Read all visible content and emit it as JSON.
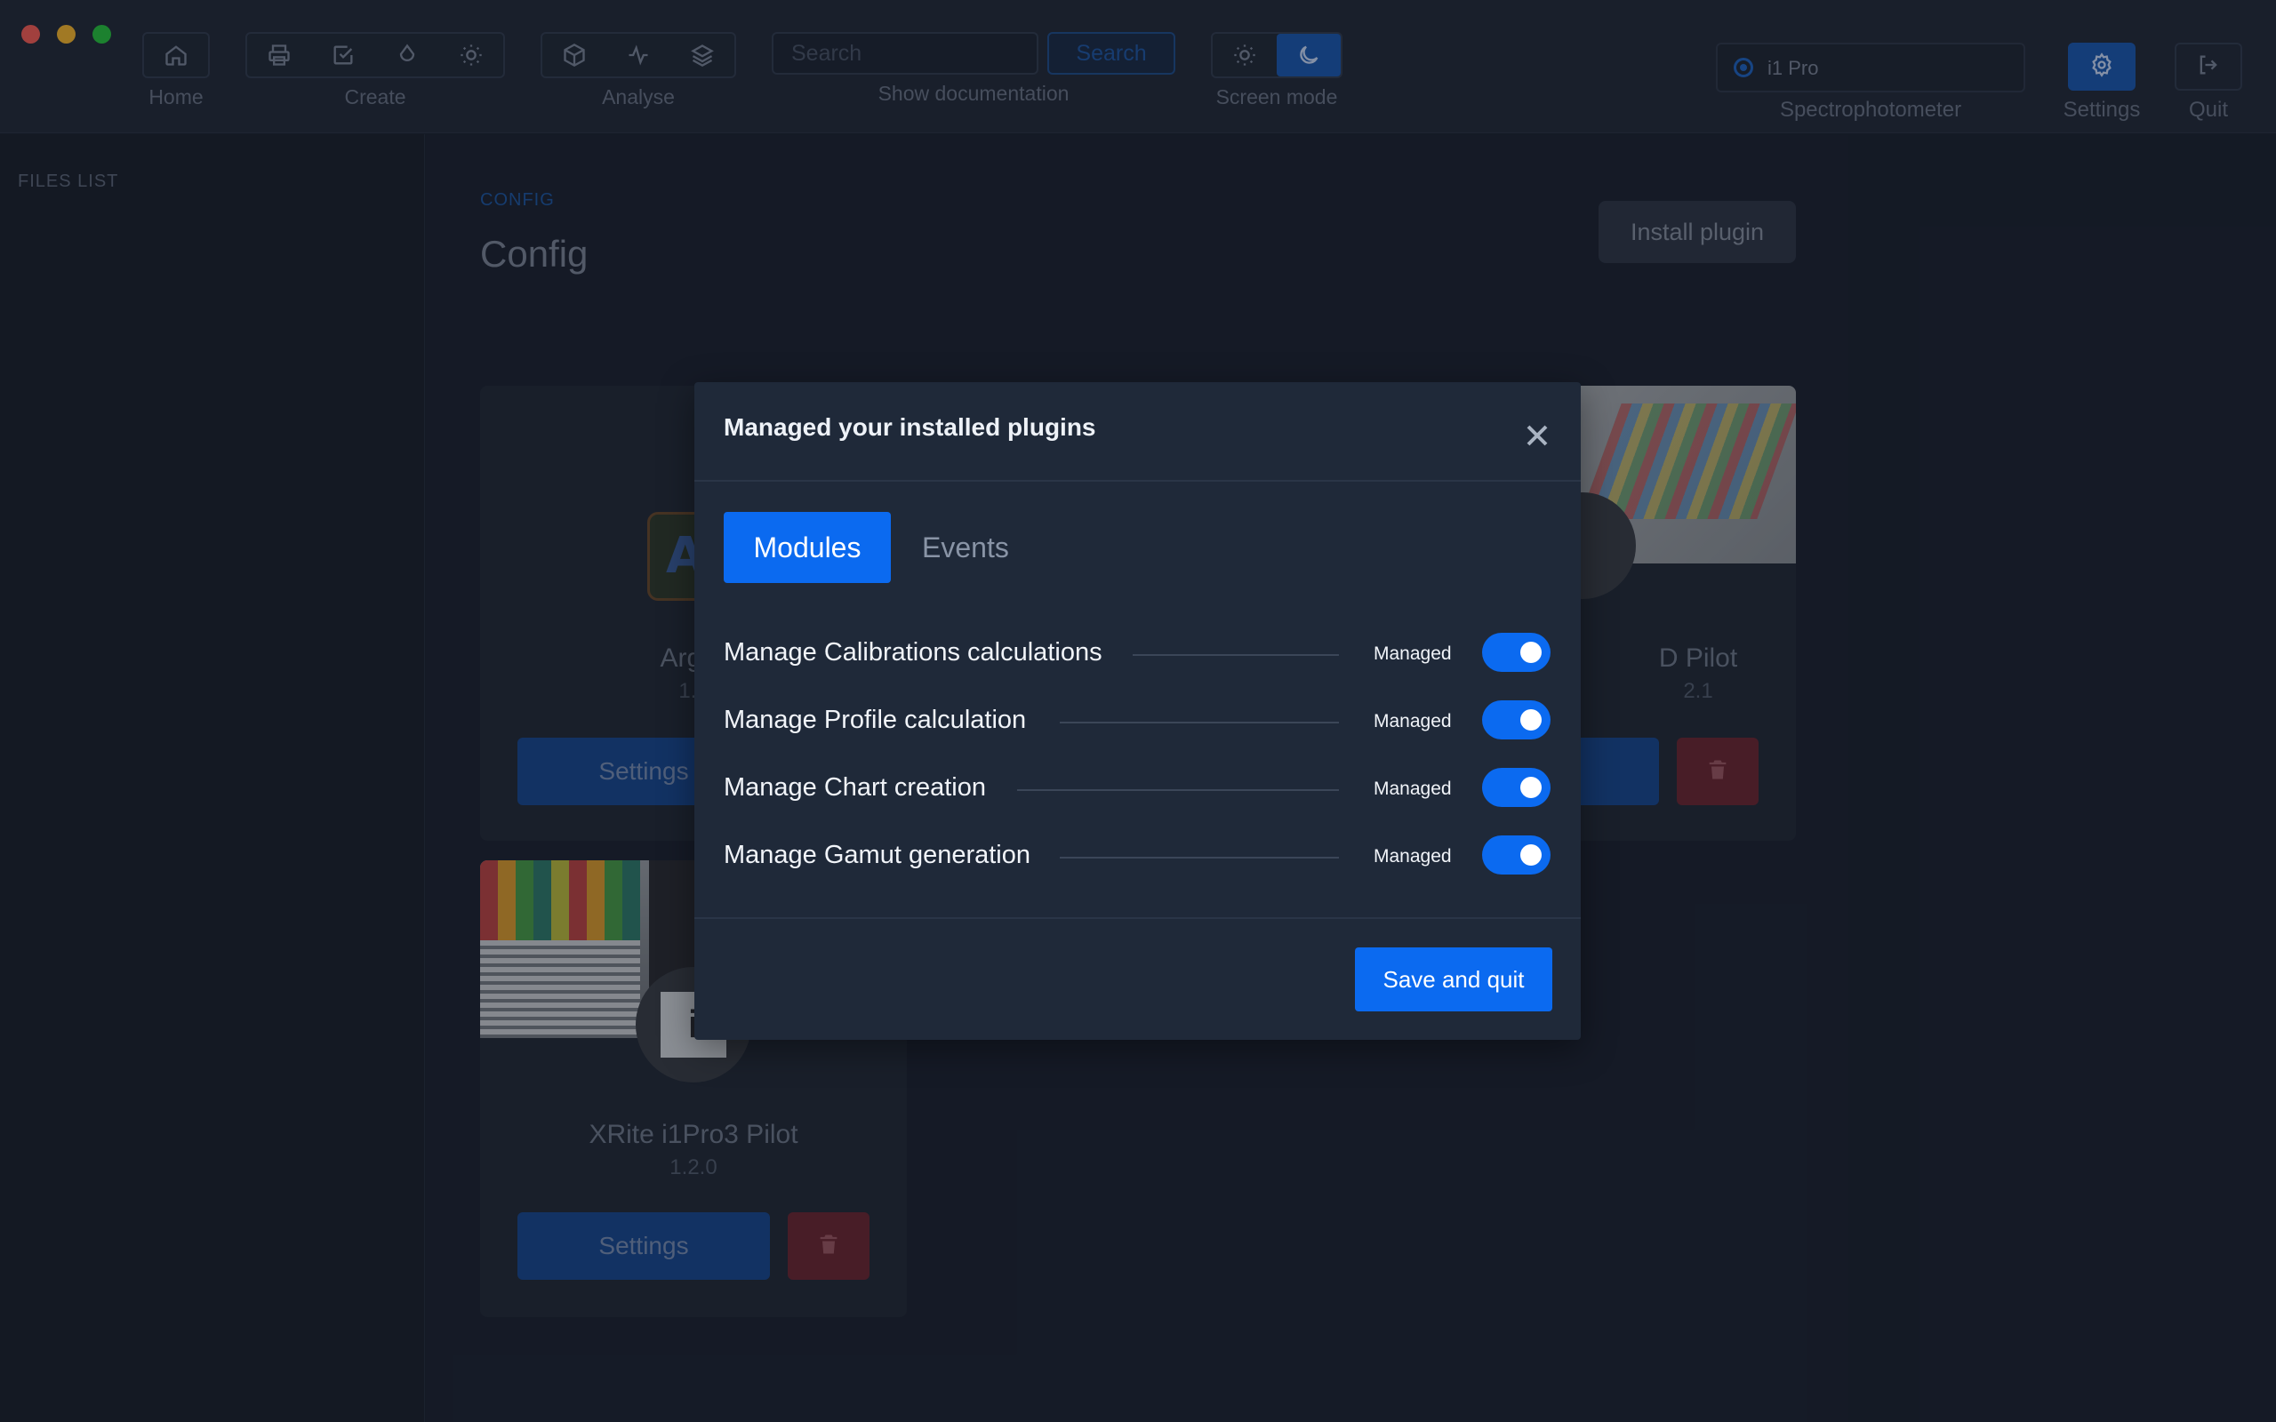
{
  "toolbar": {
    "home_label": "Home",
    "create_label": "Create",
    "analyse_label": "Analyse",
    "search_placeholder": "Search",
    "search_button": "Search",
    "doc_label": "Show documentation",
    "screen_mode_label": "Screen mode",
    "spectro_value": "i1 Pro",
    "spectro_label": "Spectrophotometer",
    "settings_label": "Settings",
    "quit_label": "Quit"
  },
  "sidebar": {
    "title": "FILES LIST"
  },
  "page": {
    "breadcrumb": "CONFIG",
    "title": "Config",
    "install_button": "Install plugin"
  },
  "cards": [
    {
      "name": "Argyll",
      "version": "1.2",
      "settings_button": "Settings"
    },
    {
      "name": "D Pilot",
      "version": "2.1"
    },
    {
      "name": "XRite i1Pro3 Pilot",
      "version": "1.2.0",
      "settings_button": "Settings"
    }
  ],
  "modal": {
    "title": "Managed your installed plugins",
    "tabs": [
      {
        "label": "Modules",
        "active": true
      },
      {
        "label": "Events",
        "active": false
      }
    ],
    "rows": [
      {
        "label": "Manage Calibrations calculations",
        "status": "Managed",
        "enabled": true
      },
      {
        "label": "Manage Profile calculation",
        "status": "Managed",
        "enabled": true
      },
      {
        "label": "Manage Chart creation",
        "status": "Managed",
        "enabled": true
      },
      {
        "label": "Manage Gamut generation",
        "status": "Managed",
        "enabled": true
      }
    ],
    "save_button": "Save and quit"
  },
  "icons": {
    "home": "home-icon",
    "print": "printer-icon",
    "check": "check-square-icon",
    "drop": "droplet-icon",
    "sun": "sun-icon",
    "cube": "cube-icon",
    "activity": "activity-icon",
    "layers": "layers-icon",
    "moon": "moon-icon",
    "gear": "gear-icon",
    "logout": "logout-icon",
    "trash": "trash-icon",
    "close": "close-icon"
  },
  "colors": {
    "accent": "#0b6af0",
    "danger": "#6e2733",
    "background": "#1b2230"
  }
}
